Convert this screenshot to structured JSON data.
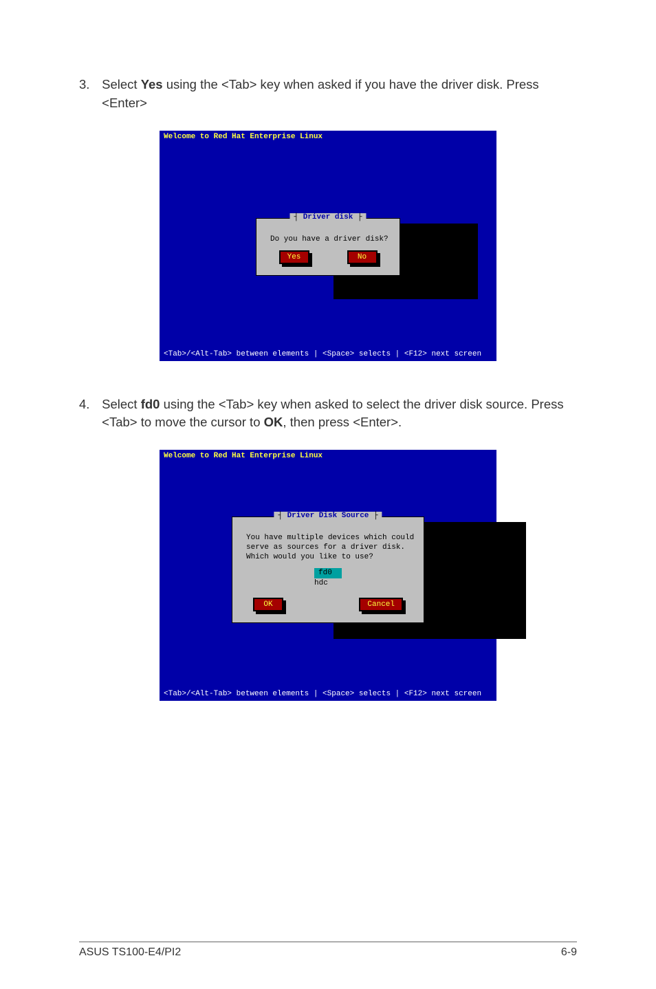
{
  "steps": {
    "s3": {
      "num": "3.",
      "pre": "Select ",
      "bold": "Yes",
      "post": " using the <Tab> key when asked if you have the driver disk. Press <Enter>"
    },
    "s4": {
      "num": "4.",
      "pre": "Select ",
      "bold": "fd0",
      "mid": " using the <Tab> key when asked to select the driver disk source. Press <Tab> to move the cursor to ",
      "bold2": "OK",
      "post": ", then press <Enter>."
    }
  },
  "screen1": {
    "title": "Welcome to Red Hat Enterprise Linux",
    "dialog_title": "Driver disk",
    "question": "Do you have a driver disk?",
    "yes": "Yes",
    "no": "No",
    "footer": "<Tab>/<Alt-Tab> between elements  | <Space> selects | <F12> next screen"
  },
  "screen2": {
    "title": "Welcome to Red Hat Enterprise Linux",
    "dialog_title": "Driver Disk Source",
    "line1": "You have multiple devices which could",
    "line2": "serve as sources for a driver disk.",
    "line3": "Which would you like to use?",
    "opt1": "fd0",
    "opt2": "hdc",
    "ok": "OK",
    "cancel": "Cancel",
    "footer": "<Tab>/<Alt-Tab> between elements  | <Space> selects | <F12> next screen"
  },
  "page_footer": {
    "left": "ASUS TS100-E4/PI2",
    "right": "6-9"
  }
}
